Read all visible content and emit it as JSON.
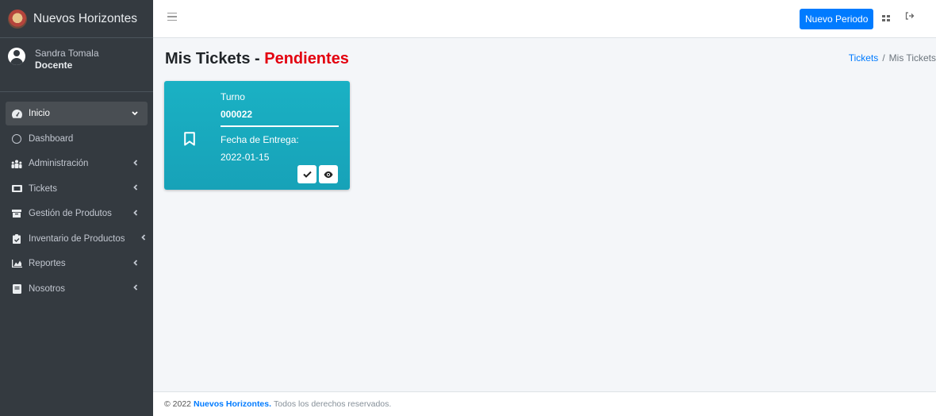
{
  "brand": {
    "name": "Nuevos Horizontes"
  },
  "user": {
    "name": "Sandra Tomala",
    "role": "Docente"
  },
  "sidebar": {
    "items": [
      {
        "label": "Inicio",
        "icon": "dashboard-gauge-icon",
        "active": true
      },
      {
        "label": "Dashboard",
        "icon": "circle-icon"
      },
      {
        "label": "Administración",
        "icon": "users-icon"
      },
      {
        "label": "Tickets",
        "icon": "ticket-icon"
      },
      {
        "label": "Gestión de Produtos",
        "icon": "box-icon"
      },
      {
        "label": "Inventario de Productos",
        "icon": "clipboard-check-icon"
      },
      {
        "label": "Reportes",
        "icon": "chart-area-icon"
      },
      {
        "label": "Nosotros",
        "icon": "book-icon"
      }
    ]
  },
  "topbar": {
    "new_period_label": "Nuevo Periodo"
  },
  "page": {
    "title": "Mis Tickets - ",
    "title_highlight": "Pendientes"
  },
  "breadcrumb": {
    "link": "Tickets",
    "separator": "/",
    "current": "Mis Tickets"
  },
  "ticket": {
    "turno_label": "Turno",
    "turno_value": "000022",
    "fecha_label": "Fecha de Entrega:",
    "fecha_value": "2022-01-15"
  },
  "footer": {
    "prefix": "© 2022",
    "brand": "Nuevos Horizontes.",
    "suffix": "Todos los derechos reservados."
  },
  "colors": {
    "sidebar": "#343a40",
    "primary": "#007bff",
    "ticket": "#17a2b8",
    "highlight": "#e3000f"
  }
}
